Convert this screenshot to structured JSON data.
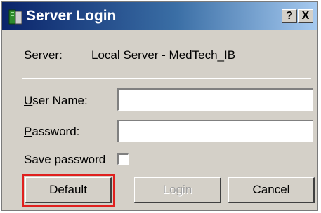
{
  "window": {
    "title": "Server Login",
    "help_label": "?",
    "close_label": "X"
  },
  "server": {
    "label": "Server:",
    "value": "Local Server - MedTech_IB"
  },
  "form": {
    "username_label": "User Name:",
    "username_value": "",
    "password_label": "Password:",
    "password_value": "",
    "save_password_label": "Save password",
    "save_password_checked": false
  },
  "buttons": {
    "default_label": "Default",
    "login_label": "Login",
    "login_enabled": false,
    "cancel_label": "Cancel"
  },
  "colors": {
    "highlight": "#e0201e",
    "titlebar": "#0a246a"
  },
  "icons": {
    "app_icon": "server-icon"
  }
}
